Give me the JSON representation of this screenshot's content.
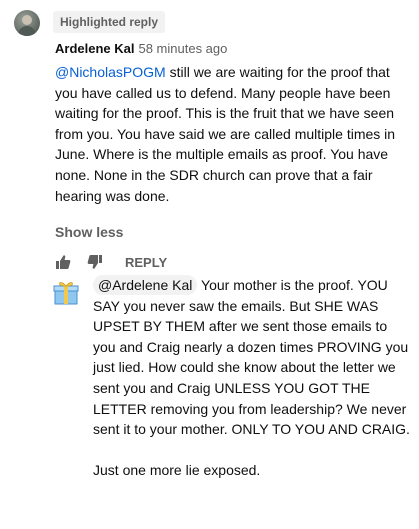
{
  "comment": {
    "badge": "Highlighted reply",
    "author": "Ardelene Kal",
    "time": "58 minutes ago",
    "mention": "@NicholasPOGM",
    "text": " still we are waiting for the proof that you have called us to defend. Many people have been waiting for the proof. This is the fruit that we have seen from you. You have said we are called multiple times in June. Where is the multiple emails as proof. You have none. None in the SDR church can prove that a fair hearing was done.",
    "show_less": "Show less"
  },
  "actions": {
    "like_icon": "thumbs-up-icon",
    "dislike_icon": "thumbs-down-icon",
    "reply_label": "REPLY"
  },
  "reply": {
    "avatar_icon": "gift-box-icon",
    "mention": "@Ardelene Kal",
    "text": " Your mother is the proof. YOU SAY you never saw the emails. But SHE WAS UPSET BY THEM after we sent those emails to you and Craig nearly a dozen times PROVING you just lied. How could she know about the letter we sent you and Craig UNLESS YOU GOT THE LETTER removing you from leadership? We never sent it to your mother. ONLY TO YOU AND CRAIG.",
    "closing": "Just one more lie exposed."
  },
  "colors": {
    "link": "#065fd4",
    "secondary_text": "#606060",
    "chip_bg": "#f2f2f2"
  }
}
